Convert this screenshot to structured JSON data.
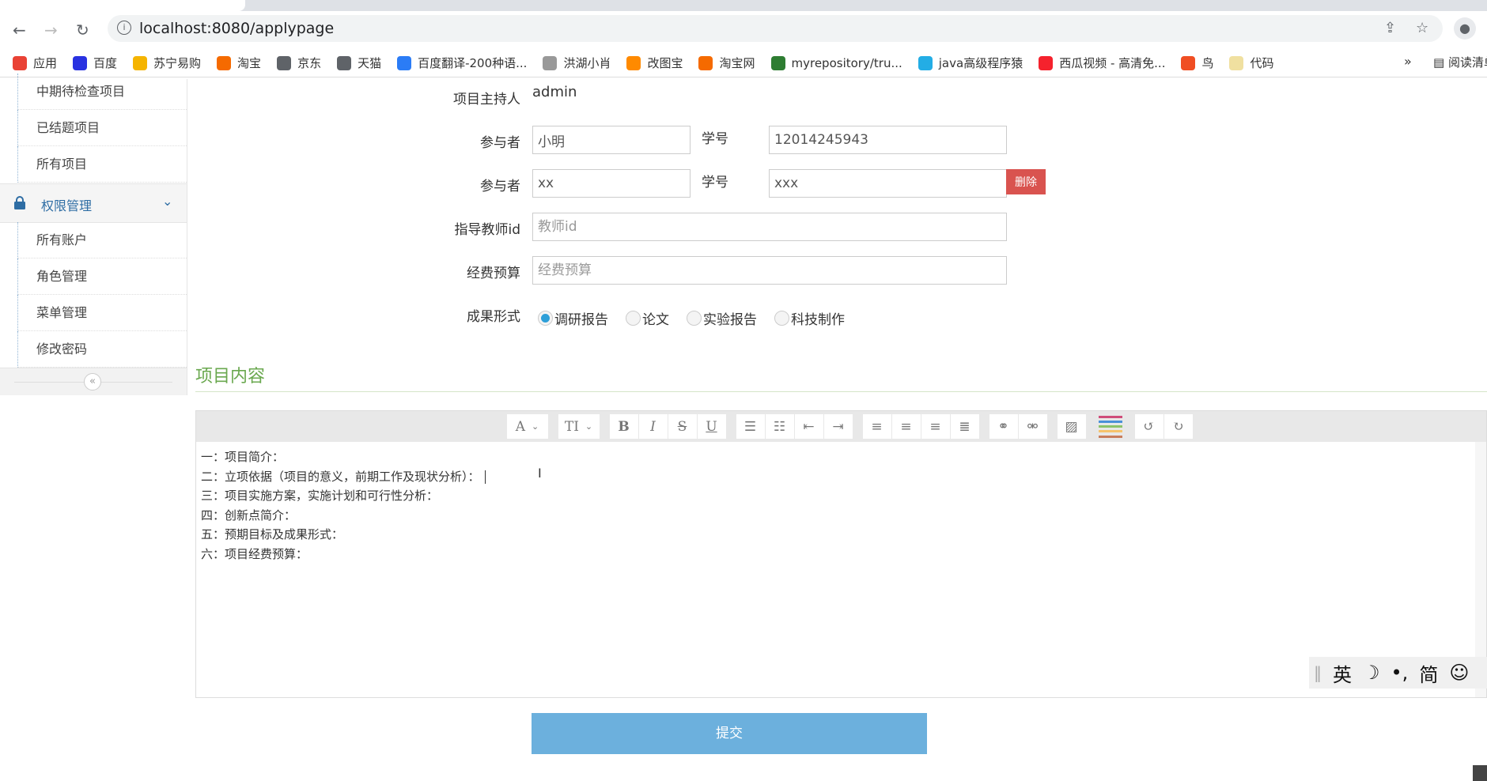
{
  "browser": {
    "url": "localhost:8080/applypage"
  },
  "bookmarks": [
    {
      "label": "应用",
      "color": "#e94235"
    },
    {
      "label": "百度",
      "color": "#2932e1"
    },
    {
      "label": "苏宁易购",
      "color": "#f5b400"
    },
    {
      "label": "淘宝",
      "color": "#f56a00"
    },
    {
      "label": "京东",
      "color": "#5f6368"
    },
    {
      "label": "天猫",
      "color": "#5f6368"
    },
    {
      "label": "百度翻译-200种语...",
      "color": "#2b7cf6"
    },
    {
      "label": "洪湖小肖",
      "color": "#999999"
    },
    {
      "label": "改图宝",
      "color": "#ff8a00"
    },
    {
      "label": "淘宝网",
      "color": "#f56a00"
    },
    {
      "label": "myrepository/tru...",
      "color": "#2e7d32"
    },
    {
      "label": "java高级程序猿",
      "color": "#23ade5"
    },
    {
      "label": "西瓜视频 - 高清免...",
      "color": "#f5222d"
    },
    {
      "label": "鸟",
      "color": "#f04e23"
    },
    {
      "label": "代码",
      "color": "#f0e0a0"
    }
  ],
  "bookmarks_more": "»",
  "reading_list": "阅读清单",
  "sidebar": {
    "items_top": [
      "中期待检查项目",
      "已结题项目",
      "所有项目"
    ],
    "group": {
      "label": "权限管理",
      "icon": "lock-icon",
      "color": "#2e6da4"
    },
    "items_group": [
      "所有账户",
      "角色管理",
      "菜单管理",
      "修改密码"
    ],
    "collapse": "«"
  },
  "form": {
    "host_label": "项目主持人",
    "host_value": "admin",
    "participants": [
      {
        "label": "参与者",
        "name": "小明",
        "id_label": "学号",
        "id": "12014245943"
      },
      {
        "label": "参与者",
        "name": "xx",
        "id_label": "学号",
        "id": "xxx",
        "delete": "删除"
      }
    ],
    "teacher_label": "指导教师id",
    "teacher_placeholder": "教师id",
    "budget_label": "经费预算",
    "budget_placeholder": "经费预算",
    "result_label": "成果形式",
    "result_options": [
      "调研报告",
      "论文",
      "实验报告",
      "科技制作"
    ],
    "result_selected": "调研报告"
  },
  "section_title": "项目内容",
  "editor": {
    "toolbar": {
      "font": "A",
      "size": "TI",
      "bold": "B",
      "italic": "I",
      "strike": "S",
      "underline": "U"
    },
    "lines": [
      "一：项目简介：",
      "二：立项依据（项目的意义，前期工作及现状分析）：",
      "三：项目实施方案，实施计划和可行性分析：",
      "四：创新点简介：",
      "五：预期目标及成果形式：",
      "六：项目经费预算："
    ]
  },
  "ime": {
    "mode": "英",
    "moon": "☽",
    "punct": "•,",
    "script": "简",
    "emoji": "☺"
  },
  "submit_label": "提交",
  "colors": {
    "accent": "#6cb0dd",
    "danger": "#d9534f",
    "section": "#6aa84f",
    "radio": "#2e9fd8"
  }
}
